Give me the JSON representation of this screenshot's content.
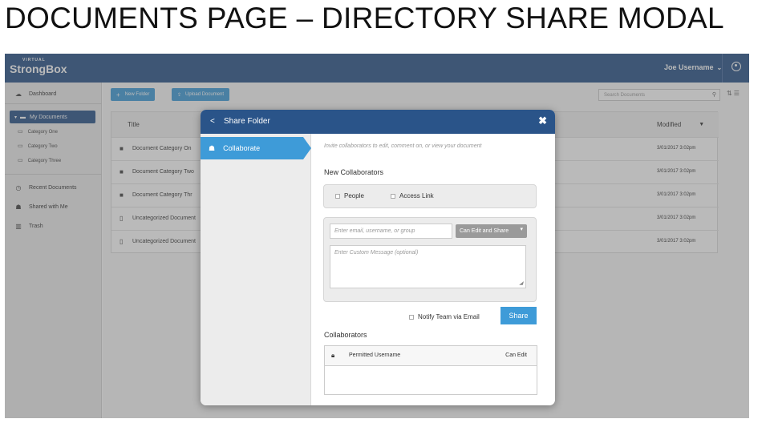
{
  "slide": {
    "title": "DOCUMENTS PAGE – DIRECTORY SHARE MODAL"
  },
  "app": {
    "logo_small": "VIRTUAL",
    "logo_big": "StrongBox",
    "user_name": "Joe Username",
    "colors": {
      "header": "#2a5489",
      "accent": "#3e9bd8",
      "sidebar": "#ededed"
    }
  },
  "sidebar": {
    "dashboard": "Dashboard",
    "my_documents": "My Documents",
    "categories": [
      "Category One",
      "Category Two",
      "Category Three"
    ],
    "recent": "Recent Documents",
    "shared": "Shared with Me",
    "trash": "Trash"
  },
  "toolbar": {
    "new_folder": "New Folder",
    "upload": "Upload Document",
    "search_placeholder": "Search Documents"
  },
  "table": {
    "col_title": "Title",
    "col_modified": "Modified",
    "rows": [
      {
        "name": "Document Category On",
        "date": "3/01/2017 3:02pm",
        "icon": "folder-icon"
      },
      {
        "name": "Document Category Two",
        "date": "3/01/2017 3:02pm",
        "icon": "folder-icon"
      },
      {
        "name": "Document Category Thr",
        "date": "3/01/2017 3:02pm",
        "icon": "folder-icon"
      },
      {
        "name": "Uncategorized Document",
        "date": "3/01/2017 3:02pm",
        "icon": "file-icon"
      },
      {
        "name": "Uncategorized Document",
        "date": "3/01/2017 3:02pm",
        "icon": "file-icon"
      }
    ]
  },
  "modal": {
    "title": "Share Folder",
    "close": "✖",
    "tab": "Collaborate",
    "hint": "Invite collaborators to edit, comment on, or view your document",
    "new_collaborators": "New Collaborators",
    "people": "People",
    "access_link": "Access Link",
    "email_placeholder": "Enter email, username, or group",
    "permission": "Can Edit and Share",
    "message_placeholder": "Enter Custom Message (optional)",
    "notify": "Notify Team via Email",
    "share": "Share",
    "collaborators": "Collaborators",
    "permitted_username": "Permitted Username",
    "can_edit": "Can Edit"
  }
}
